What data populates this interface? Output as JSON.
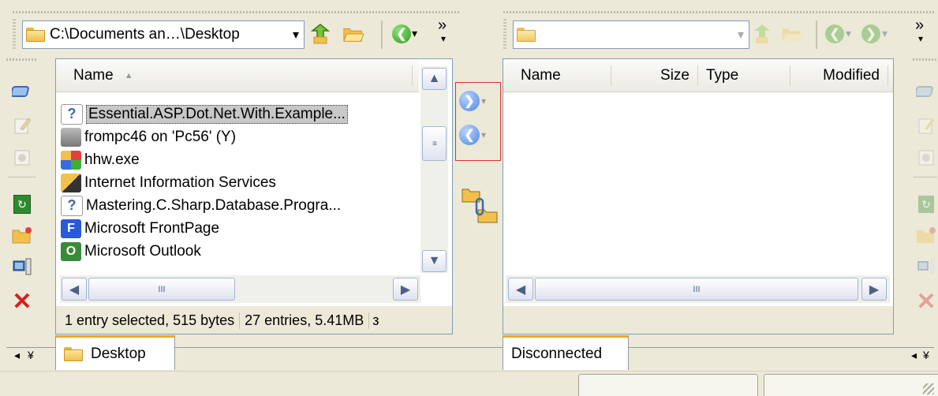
{
  "left_pane": {
    "path": "C:\\Documents an…\\Desktop",
    "columns": [
      {
        "label": "Name"
      }
    ],
    "sort_indicator": "▲",
    "files": [
      {
        "name": "Essential.ASP.Dot.Net.With.Example...",
        "icon": "unknown-file-icon",
        "selected": true
      },
      {
        "name": "frompc46 on 'Pc56' (Y)",
        "icon": "network-drive-icon"
      },
      {
        "name": "hhw.exe",
        "icon": "executable-icon"
      },
      {
        "name": "Internet Information Services",
        "icon": "iis-icon"
      },
      {
        "name": "Mastering.C.Sharp.Database.Progra...",
        "icon": "unknown-file-icon"
      },
      {
        "name": "Microsoft FrontPage",
        "icon": "frontpage-icon"
      },
      {
        "name": "Microsoft Outlook",
        "icon": "outlook-icon"
      }
    ],
    "status_selection": "1 entry selected, 515 bytes",
    "status_entries": "27 entries, 5.41MB",
    "status_overflow": "з",
    "tab_label": "Desktop"
  },
  "right_pane": {
    "path": "",
    "columns": [
      {
        "label": "Name"
      },
      {
        "label": "Size"
      },
      {
        "label": "Type"
      },
      {
        "label": "Modified"
      }
    ],
    "tab_label": "Disconnected"
  },
  "toolbar": {
    "overflow_glyph": "»",
    "dropdown_glyph": "▾"
  },
  "side_toolbar": {
    "collapse_left": "◂",
    "collapse_expand": "¥",
    "collapse_right": "◂"
  },
  "scroll": {
    "up": "▲",
    "down": "▼",
    "left": "◀",
    "right": "▶",
    "grip": "III"
  },
  "colors": {
    "background": "#ece9d8",
    "selection": "#c8c8c8",
    "tab_accent": "#f5a623",
    "highlight_box": "#e03030",
    "delete": "#d42020",
    "nav_blue": "#4f86e0"
  }
}
